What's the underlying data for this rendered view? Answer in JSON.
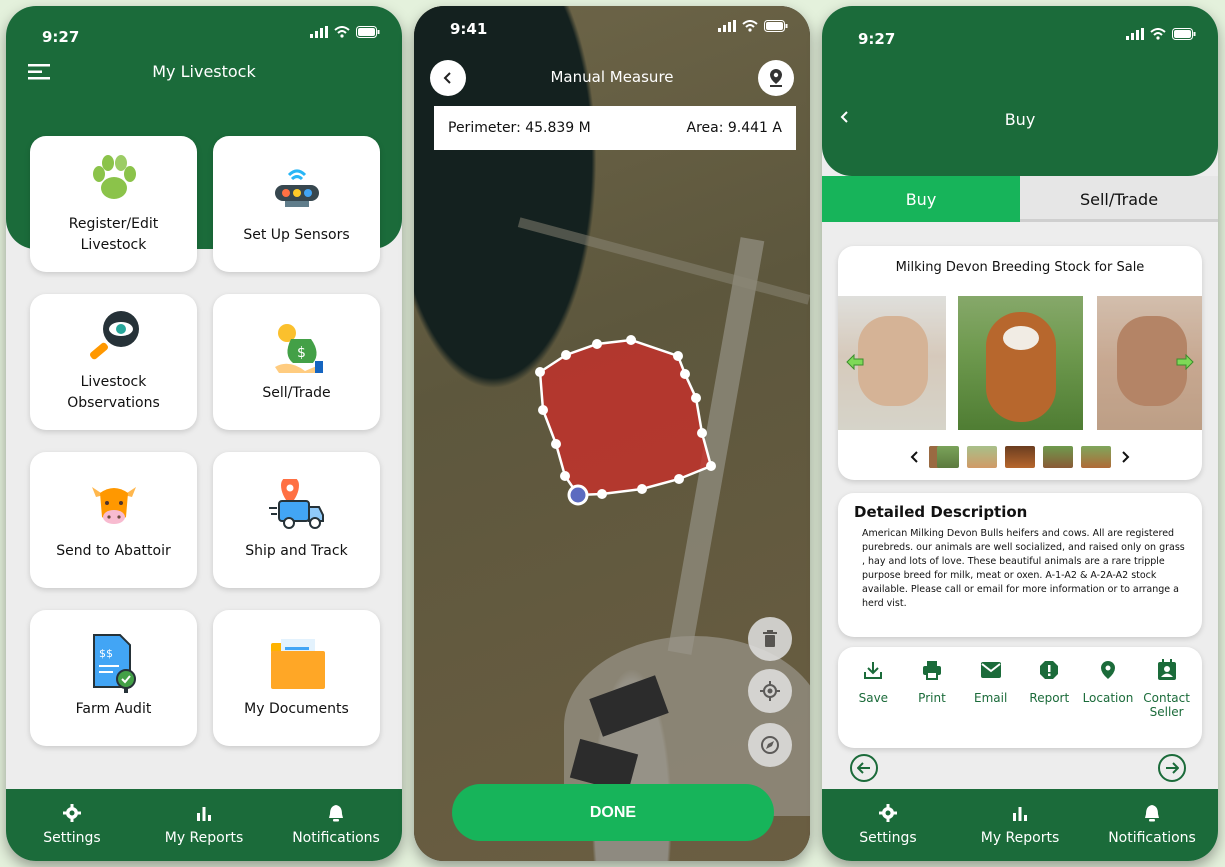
{
  "screen1": {
    "status_time": "9:27",
    "title": "My Livestock",
    "tiles": [
      {
        "label": "Register/Edit Livestock",
        "icon": "paw-icon"
      },
      {
        "label": "Set Up Sensors",
        "icon": "sensor-icon"
      },
      {
        "label": "Livestock Observations",
        "icon": "eye-magnifier-icon"
      },
      {
        "label": "Sell/Trade",
        "icon": "money-bag-icon"
      },
      {
        "label": "Send to Abattoir",
        "icon": "cow-head-icon"
      },
      {
        "label": "Ship and Track",
        "icon": "delivery-truck-icon"
      },
      {
        "label": "Farm Audit",
        "icon": "audit-document-icon"
      },
      {
        "label": "My Documents",
        "icon": "folder-icon"
      }
    ],
    "nav": [
      {
        "label": "Settings",
        "icon": "gear-icon"
      },
      {
        "label": "My Reports",
        "icon": "bar-chart-icon"
      },
      {
        "label": "Notifications",
        "icon": "bell-icon"
      }
    ]
  },
  "screen2": {
    "status_time": "9:41",
    "title": "Manual Measure",
    "perimeter": "Perimeter: 45.839 M",
    "area": "Area: 9.441 A",
    "done_label": "DONE",
    "colors": {
      "polygon_fill": "#c8302a",
      "done": "#17b45a"
    }
  },
  "screen3": {
    "status_time": "9:27",
    "title": "Buy",
    "tabs": [
      "Buy",
      "Sell/Trade"
    ],
    "listing_title": "Milking Devon Breeding Stock for Sale",
    "desc_title": "Detailed Description",
    "desc_text": "American Milking Devon Bulls heifers and cows. All are registered purebreds. our animals are well socialized, and raised only on grass , hay and lots of love. These beautiful animals are a rare tripple purpose breed for milk, meat or oxen. A-1-A2 & A-2A-A2 stock available. Please call or email for more information or to arrange a herd vist.",
    "actions": [
      {
        "label": "Save",
        "icon": "download-icon"
      },
      {
        "label": "Print",
        "icon": "print-icon"
      },
      {
        "label": "Email",
        "icon": "email-icon"
      },
      {
        "label": "Report",
        "icon": "report-icon"
      },
      {
        "label": "Location",
        "icon": "location-pin-icon"
      },
      {
        "label": "Contact Seller",
        "icon": "contact-icon"
      }
    ],
    "nav": [
      {
        "label": "Settings",
        "icon": "gear-icon"
      },
      {
        "label": "My Reports",
        "icon": "bar-chart-icon"
      },
      {
        "label": "Notifications",
        "icon": "bell-icon"
      }
    ]
  },
  "colors": {
    "primary_green": "#1b6b3a",
    "accent_green": "#17b45a",
    "background": "#e4f1dc"
  }
}
